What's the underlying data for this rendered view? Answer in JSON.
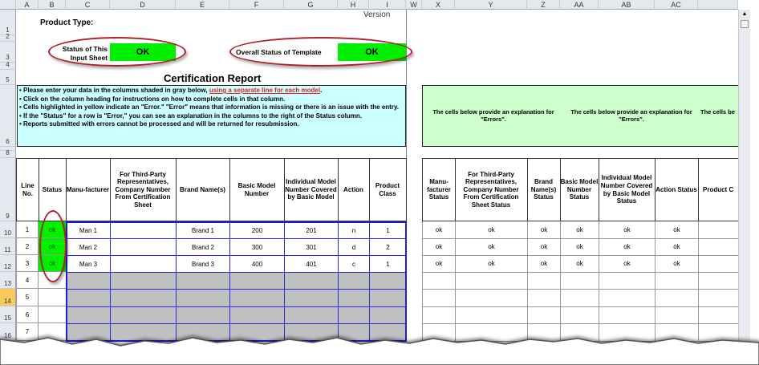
{
  "columns": [
    "A",
    "B",
    "C",
    "D",
    "E",
    "F",
    "G",
    "H",
    "I",
    "W",
    "X",
    "Y",
    "Z",
    "AA",
    "AB",
    "AC"
  ],
  "rows": [
    "1",
    "2",
    "3",
    "4",
    "5",
    "6",
    "",
    "8",
    "9",
    "10",
    "11",
    "12",
    "13",
    "14",
    "15",
    "16"
  ],
  "selected_row": "14",
  "top": {
    "version": "Version",
    "product_type": "Product Type:",
    "status_sheet_label": "Status of This Input Sheet",
    "status_sheet_value": "OK",
    "status_template_label": "Overall Status of Template",
    "status_template_value": "OK"
  },
  "title": "Certification Report",
  "instructions": {
    "line1_pre": "• Please enter your data in the columns shaded in gray below,",
    "line1_link": "using a separate line for each model",
    "line1_post": ".",
    "line2": "• Click on the column heading for instructions on how to complete cells in that column.",
    "line3": "• Cells highlighted in yellow indicate an \"Error.\"  \"Error\" means that information is missing or there is an issue with the entry.",
    "line4": "• If the \"Status\" for a row is \"Error,\" you can see an explanation in the columns to the right of the Status column.",
    "line5": "• Reports submitted with errors cannot be processed and will be returned for resubmission."
  },
  "explanation": [
    "The cells below provide an explanation for \"Errors\".",
    "The cells below provide an explanation for \"Errors\".",
    "The cells be"
  ],
  "headers_left": [
    "Line No.",
    "Status",
    "Manu-facturer",
    "For Third-Party Representatives, Company Number From Certification Sheet",
    "Brand Name(s)",
    "Basic Model Number",
    "Individual Model Number Covered by Basic Model",
    "Action",
    "Product Class"
  ],
  "headers_right": [
    "Manu-facturer Status",
    "For Third-Party Representatives, Company Number From Certification Sheet Status",
    "Brand Name(s) Status",
    "Basic Model Number Status",
    "Individual Model Number Covered by Basic Model Status",
    "Action Status",
    "Product C"
  ],
  "data_rows": [
    {
      "line": "1",
      "status": "ok",
      "manufacturer": "Man 1",
      "company": "",
      "brand": "Brand 1",
      "basic": "200",
      "individual": "201",
      "action": "n",
      "class": "1",
      "right": [
        "ok",
        "ok",
        "ok",
        "ok",
        "ok",
        "ok"
      ]
    },
    {
      "line": "2",
      "status": "ok",
      "manufacturer": "Man 2",
      "company": "",
      "brand": "Brand 2",
      "basic": "300",
      "individual": "301",
      "action": "d",
      "class": "2",
      "right": [
        "ok",
        "ok",
        "ok",
        "ok",
        "ok",
        "ok"
      ]
    },
    {
      "line": "3",
      "status": "ok",
      "manufacturer": "Man 3",
      "company": "",
      "brand": "Brand 3",
      "basic": "400",
      "individual": "401",
      "action": "c",
      "class": "1",
      "right": [
        "ok",
        "ok",
        "ok",
        "ok",
        "ok",
        "ok"
      ]
    },
    {
      "line": "4"
    },
    {
      "line": "5"
    },
    {
      "line": "6"
    },
    {
      "line": "7"
    }
  ],
  "colors": {
    "ok_green": "#00f000",
    "instructions_bg": "#ccffff",
    "explanation_bg": "#ccffcc",
    "input_gray": "#c0c0c0",
    "input_border": "#1f1fd0",
    "ellipse": "#b0202a",
    "link_red": "#e0201f"
  }
}
